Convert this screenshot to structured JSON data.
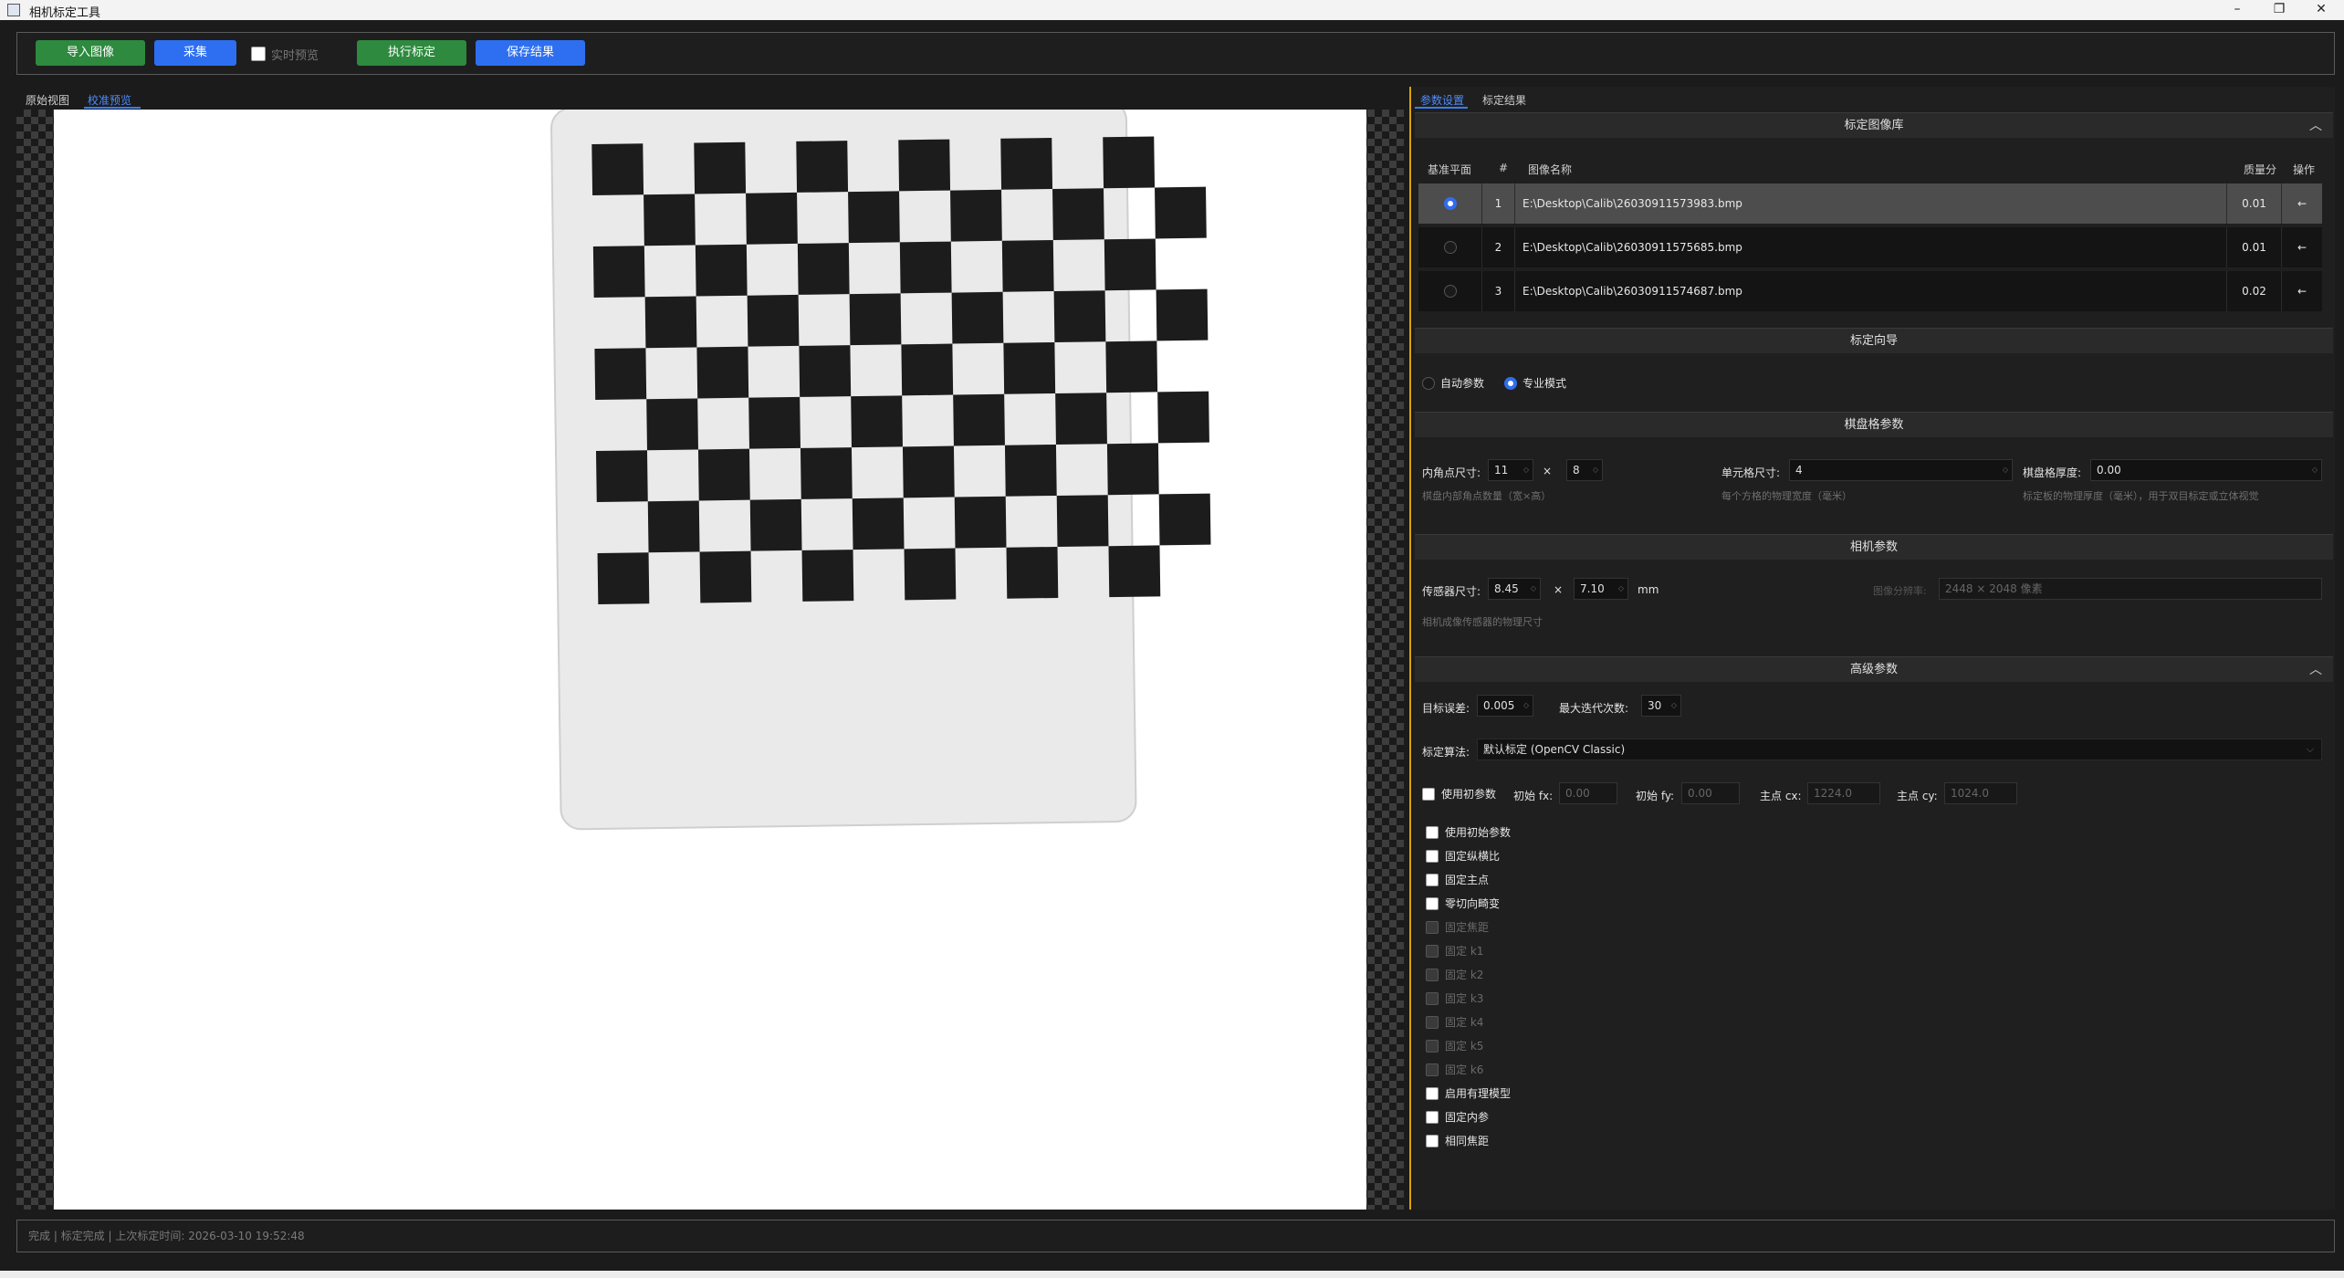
{
  "window": {
    "title": "相机标定工具",
    "minimize": "–",
    "restore": "❐",
    "close": "✕"
  },
  "toolbar": {
    "import_label": "导入图像",
    "capture_label": "采集",
    "live_preview_label": "实时预览",
    "run_calib_label": "执行标定",
    "save_label": "保存结果"
  },
  "view_tabs": [
    "原始视图",
    "校准预览"
  ],
  "panel_tabs": [
    "参数设置",
    "标定结果"
  ],
  "image_library": {
    "header": "标定图像库",
    "columns": [
      "基准平面",
      "#",
      "图像名称",
      "质量分",
      "操作"
    ],
    "rows": [
      {
        "index": "1",
        "name": "E:\\Desktop\\Calib\\26030911573983.bmp",
        "score": "0.01",
        "selected": true
      },
      {
        "index": "2",
        "name": "E:\\Desktop\\Calib\\26030911575685.bmp",
        "score": "0.01",
        "selected": false
      },
      {
        "index": "3",
        "name": "E:\\Desktop\\Calib\\26030911574687.bmp",
        "score": "0.02",
        "selected": false
      }
    ],
    "delete_icon": "←"
  },
  "wizard": {
    "header": "标定向导",
    "auto_label": "自动参数",
    "pro_label": "专业模式",
    "mode": "专业模式"
  },
  "checkerboard": {
    "header": "棋盘格参数",
    "inner_label": "内角点尺寸:",
    "inner_w": "11",
    "inner_x": "×",
    "inner_h": "8",
    "inner_hint": "棋盘内部角点数量（宽×高）",
    "cell_label": "单元格尺寸:",
    "cell_value": "4",
    "cell_hint": "每个方格的物理宽度（毫米）",
    "thick_label": "棋盘格厚度:",
    "thick_value": "0.00",
    "thick_hint": "标定板的物理厚度（毫米），用于双目标定或立体视觉"
  },
  "camera": {
    "header": "相机参数",
    "sensor_label": "传感器尺寸:",
    "sensor_w": "8.45",
    "sensor_x": "×",
    "sensor_h": "7.10",
    "sensor_unit": "mm",
    "res_label": "图像分辨率:",
    "res_value": "2448 × 2048 像素",
    "sensor_hint": "相机成像传感器的物理尺寸"
  },
  "advanced": {
    "header": "高级参数",
    "target_err_label": "目标误差:",
    "target_err": "0.005",
    "max_iter_label": "最大迭代次数:",
    "max_iter": "30",
    "algo_label": "标定算法:",
    "algo_value": "默认标定 (OpenCV Classic)",
    "use_init_label": "使用初参数",
    "fx_label": "初始 fx:",
    "fx_value": "0.00",
    "fy_label": "初始 fy:",
    "fy_value": "0.00",
    "cx_label": "主点 cx:",
    "cx_value": "1224.0",
    "cy_label": "主点 cy:",
    "cy_value": "1024.0",
    "flags": [
      {
        "label": "使用初始参数",
        "enabled": true
      },
      {
        "label": "固定纵横比",
        "enabled": true
      },
      {
        "label": "固定主点",
        "enabled": true
      },
      {
        "label": "零切向畸变",
        "enabled": true
      },
      {
        "label": "固定焦距",
        "enabled": false
      },
      {
        "label": "固定 k1",
        "enabled": false
      },
      {
        "label": "固定 k2",
        "enabled": false
      },
      {
        "label": "固定 k3",
        "enabled": false
      },
      {
        "label": "固定 k4",
        "enabled": false
      },
      {
        "label": "固定 k5",
        "enabled": false
      },
      {
        "label": "固定 k6",
        "enabled": false
      },
      {
        "label": "启用有理模型",
        "enabled": true
      },
      {
        "label": "固定内参",
        "enabled": true
      },
      {
        "label": "相同焦距",
        "enabled": true
      }
    ]
  },
  "status": {
    "text": "完成 | 标定完成 | 上次标定时间: 2026-03-10 19:52:48"
  },
  "colors": {
    "accent_blue": "#2d6ff0",
    "accent_green": "#2d8a3e",
    "delete_red": "#e03b3b",
    "splitter": "#d7a400"
  },
  "icons": {
    "collapse": "chevron-up-icon",
    "spin": "spin-arrows-icon",
    "delete": "delete-arrow-icon"
  }
}
